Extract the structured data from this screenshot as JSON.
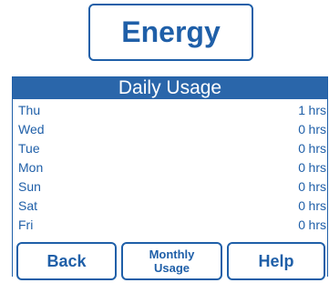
{
  "header": {
    "title": "Energy"
  },
  "panel": {
    "title": "Daily Usage",
    "rows": [
      {
        "day": "Thu",
        "value": "1",
        "unit": "hrs"
      },
      {
        "day": "Wed",
        "value": "0",
        "unit": "hrs"
      },
      {
        "day": "Tue",
        "value": "0",
        "unit": "hrs"
      },
      {
        "day": "Mon",
        "value": "0",
        "unit": "hrs"
      },
      {
        "day": "Sun",
        "value": "0",
        "unit": "hrs"
      },
      {
        "day": "Sat",
        "value": "0",
        "unit": "hrs"
      },
      {
        "day": "Fri",
        "value": "0",
        "unit": "hrs"
      }
    ]
  },
  "buttons": {
    "back": "Back",
    "monthly_line1": "Monthly",
    "monthly_line2": "Usage",
    "help": "Help"
  },
  "colors": {
    "accent": "#1f5fa8",
    "header_bg": "#2a66aa"
  }
}
